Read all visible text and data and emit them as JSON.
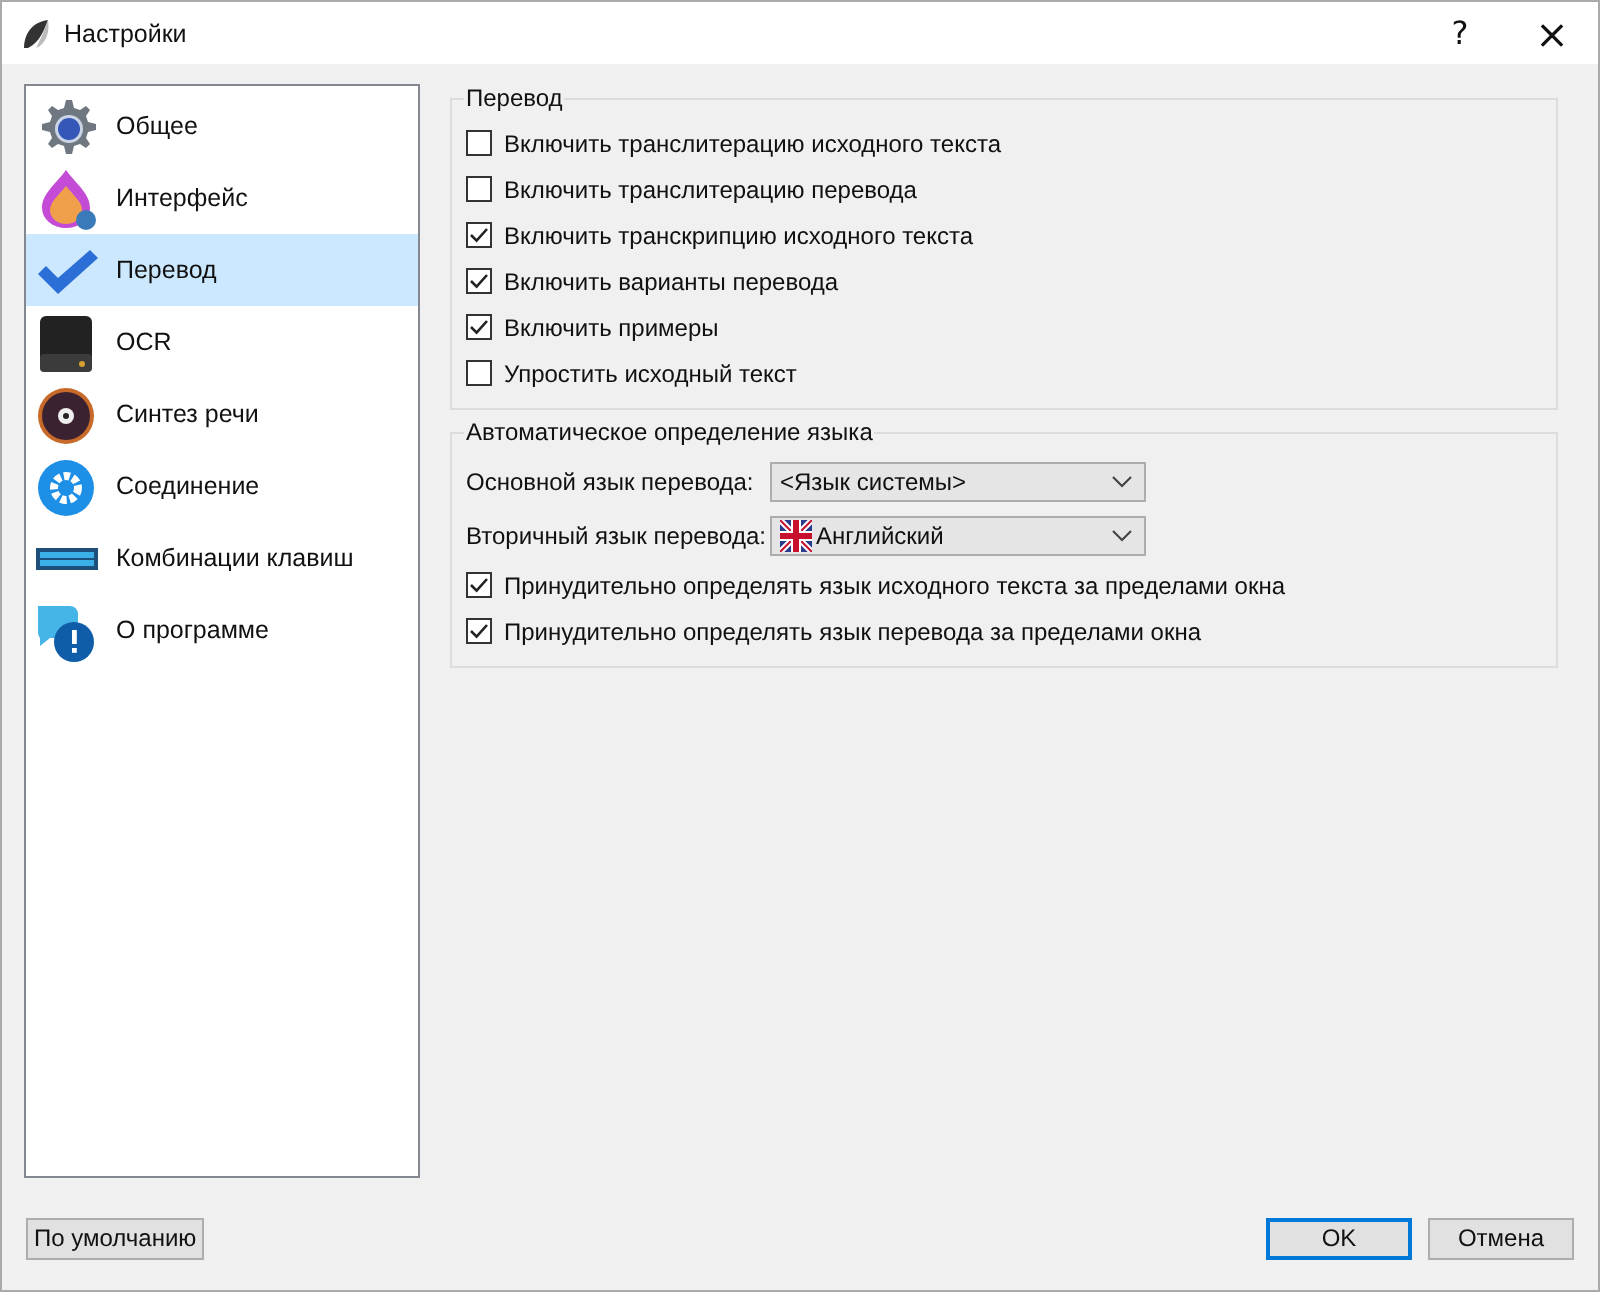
{
  "window": {
    "title": "Настройки",
    "help": "?",
    "close": "×"
  },
  "sidebar": {
    "items": [
      {
        "label": "Общее",
        "selected": false
      },
      {
        "label": "Интерфейс",
        "selected": false
      },
      {
        "label": "Перевод",
        "selected": true
      },
      {
        "label": "OCR",
        "selected": false
      },
      {
        "label": "Синтез речи",
        "selected": false
      },
      {
        "label": "Соединение",
        "selected": false
      },
      {
        "label": "Комбинации клавиш",
        "selected": false
      },
      {
        "label": "О программе",
        "selected": false
      }
    ]
  },
  "groups": [
    {
      "title": "Перевод",
      "rows": [
        {
          "kind": "checkbox",
          "label": "Включить транслитерацию исходного текста",
          "checked": false
        },
        {
          "kind": "checkbox",
          "label": "Включить транслитерацию перевода",
          "checked": false
        },
        {
          "kind": "checkbox",
          "label": "Включить транскрипцию исходного текста",
          "checked": true
        },
        {
          "kind": "checkbox",
          "label": "Включить варианты перевода",
          "checked": true
        },
        {
          "kind": "checkbox",
          "label": "Включить примеры",
          "checked": true
        },
        {
          "kind": "checkbox",
          "label": "Упростить исходный текст",
          "checked": false
        }
      ]
    },
    {
      "title": "Автоматическое определение языка",
      "rows": [
        {
          "kind": "combo",
          "label": "Основной язык перевода:",
          "value": "<Язык системы>"
        },
        {
          "kind": "language-combo",
          "label": "Вторичный язык перевода:",
          "value": "Английский"
        },
        {
          "kind": "checkbox",
          "label": "Принудительно определять язык исходного текста за пределами окна",
          "checked": true
        },
        {
          "kind": "checkbox",
          "label": "Принудительно определять язык перевода за пределами окна",
          "checked": true
        }
      ]
    }
  ],
  "footer": {
    "reset": "По умолчанию",
    "ok": "OK",
    "cancel": "Отмена"
  }
}
